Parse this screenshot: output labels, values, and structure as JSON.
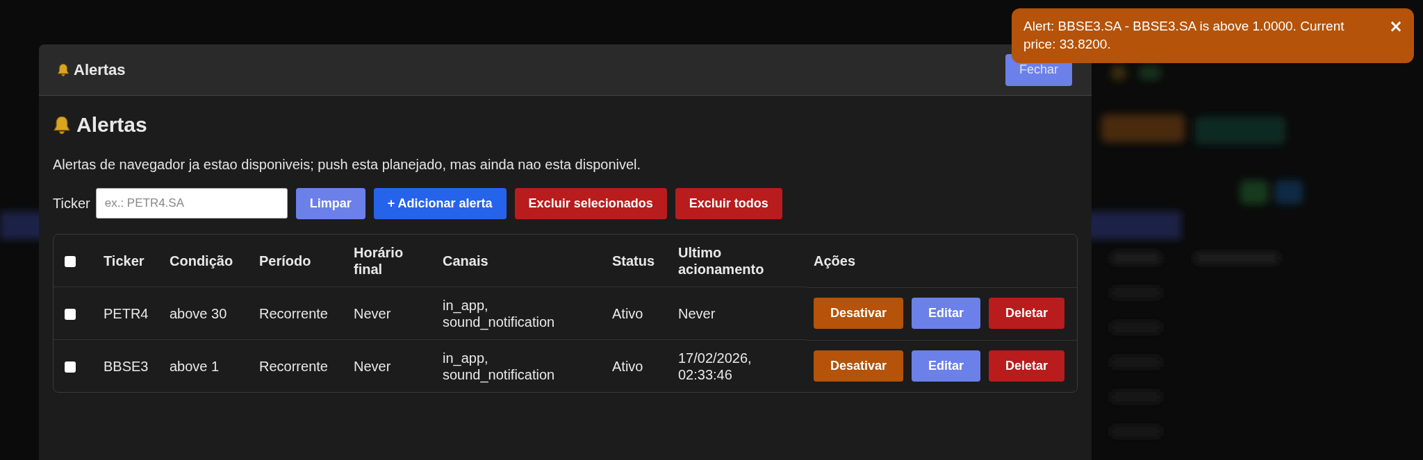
{
  "modal": {
    "title": "Alertas",
    "close_button": "Fechar"
  },
  "heading": "Alertas",
  "description": "Alertas de navegador ja estao disponiveis; push esta planejado, mas ainda nao esta disponivel.",
  "form": {
    "label": "Ticker",
    "placeholder": "ex.: PETR4.SA",
    "buttons": [
      {
        "label": "Limpar",
        "kind": "secondary"
      },
      {
        "label": "+ Adicionar alerta",
        "kind": "primary"
      },
      {
        "label": "Excluir selecionados",
        "kind": "danger"
      },
      {
        "label": "Excluir todos",
        "kind": "danger"
      }
    ]
  },
  "table": {
    "select_all": {
      "checked": false
    },
    "columns": [
      "Ticker",
      "Condição",
      "Período",
      "Horário final",
      "Canais",
      "Status",
      "Ultimo acionamento",
      "Ações"
    ],
    "rows": [
      {
        "selected": false,
        "cells": [
          "PETR4",
          "above 30",
          "Recorrente",
          "Never",
          "in_app, sound_notification",
          "Ativo",
          "Never"
        ],
        "actions": [
          {
            "label": "Desativar",
            "kind": "warning"
          },
          {
            "label": "Editar",
            "kind": "secondary"
          },
          {
            "label": "Deletar",
            "kind": "danger"
          }
        ]
      },
      {
        "selected": false,
        "cells": [
          "BBSE3",
          "above 1",
          "Recorrente",
          "Never",
          "in_app, sound_notification",
          "Ativo",
          "17/02/2026, 02:33:46"
        ],
        "actions": [
          {
            "label": "Desativar",
            "kind": "warning"
          },
          {
            "label": "Editar",
            "kind": "secondary"
          },
          {
            "label": "Deletar",
            "kind": "danger"
          }
        ]
      }
    ]
  },
  "toast": {
    "message": "Alert: BBSE3.SA - BBSE3.SA is above 1.0000. Current price: 33.8200.",
    "close": "×"
  }
}
